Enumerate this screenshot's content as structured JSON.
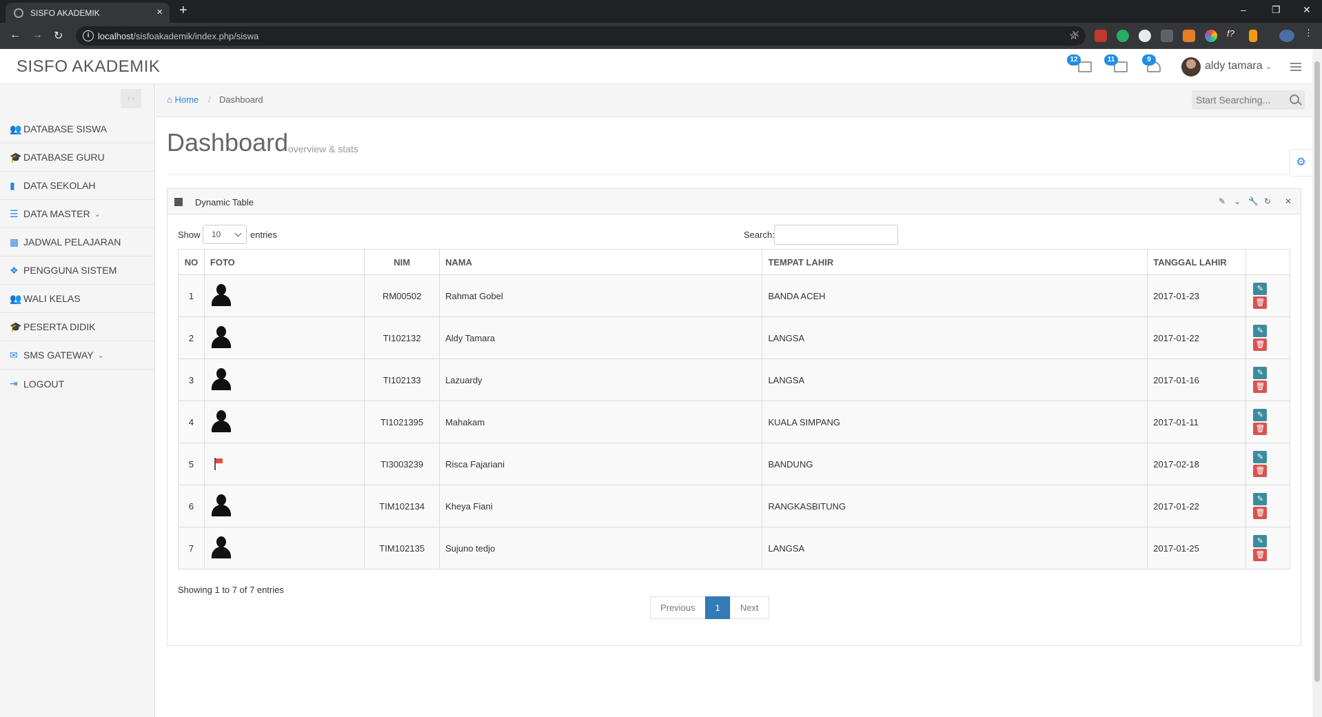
{
  "browser": {
    "tab_title": "SISFO AKADEMIK",
    "url_host": "localhost",
    "url_path": "/sisfoakademik/index.php/siswa"
  },
  "header": {
    "brand": "SISFO AKADEMIK",
    "badges": {
      "messages": "12",
      "notifications": "11",
      "tasks": "9"
    },
    "user_name": "aldy tamara"
  },
  "sidebar": {
    "items": [
      {
        "label": "DATABASE SISWA",
        "icon": "users-icon"
      },
      {
        "label": "DATABASE GURU",
        "icon": "graduation-cap-icon"
      },
      {
        "label": "DATA SEKOLAH",
        "icon": "book-icon"
      },
      {
        "label": "DATA MASTER",
        "icon": "list-icon"
      },
      {
        "label": "JADWAL PELAJARAN",
        "icon": "calendar-icon"
      },
      {
        "label": "PENGGUNA SISTEM",
        "icon": "cubes-icon"
      },
      {
        "label": "WALI KELAS",
        "icon": "users-icon"
      },
      {
        "label": "PESERTA DIDIK",
        "icon": "graduation-cap-icon"
      },
      {
        "label": "SMS GATEWAY",
        "icon": "envelope-icon"
      },
      {
        "label": "LOGOUT",
        "icon": "sign-out-icon"
      }
    ]
  },
  "breadcrumb": {
    "home": "Home",
    "current": "Dashboard"
  },
  "search": {
    "placeholder": "Start Searching..."
  },
  "page": {
    "title": "Dashboard",
    "subtitle": "overview & stats"
  },
  "widget": {
    "title": "Dynamic Table",
    "show_label": "Show",
    "entries_value": "10",
    "entries_label": "entries",
    "search_label": "Search:",
    "columns": [
      "NO",
      "FOTO",
      "NIM",
      "NAMA",
      "TEMPAT LAHIR",
      "TANGGAL LAHIR"
    ],
    "rows": [
      {
        "no": "1",
        "photo": "person-silhouette",
        "nim": "RM00502",
        "nama": "Rahmat Gobel",
        "tempat_lahir": "BANDA ACEH",
        "tanggal_lahir": "2017-01-23"
      },
      {
        "no": "2",
        "photo": "person-silhouette",
        "nim": "TI102132",
        "nama": "Aldy Tamara",
        "tempat_lahir": "LANGSA",
        "tanggal_lahir": "2017-01-22"
      },
      {
        "no": "3",
        "photo": "person-silhouette",
        "nim": "TI102133",
        "nama": "Lazuardy",
        "tempat_lahir": "LANGSA",
        "tanggal_lahir": "2017-01-16"
      },
      {
        "no": "4",
        "photo": "person-silhouette",
        "nim": "TI1021395",
        "nama": "Mahakam",
        "tempat_lahir": "KUALA SIMPANG",
        "tanggal_lahir": "2017-01-11"
      },
      {
        "no": "5",
        "photo": "flag-image",
        "nim": "TI3003239",
        "nama": "Risca Fajariani",
        "tempat_lahir": "BANDUNG",
        "tanggal_lahir": "2017-02-18"
      },
      {
        "no": "6",
        "photo": "person-silhouette",
        "nim": "TIM102134",
        "nama": "Kheya Fiani",
        "tempat_lahir": "RANGKASBITUNG",
        "tanggal_lahir": "2017-01-22"
      },
      {
        "no": "7",
        "photo": "person-silhouette",
        "nim": "TIM102135",
        "nama": "Sujuno tedjo",
        "tempat_lahir": "LANGSA",
        "tanggal_lahir": "2017-01-25"
      }
    ],
    "info": "Showing 1 to 7 of 7 entries",
    "pagination": {
      "previous": "Previous",
      "current": "1",
      "next": "Next"
    }
  },
  "colors": {
    "accent": "#2e86de",
    "edit": "#3d8b9e",
    "delete": "#d9534f",
    "badge": "#1f8fe6",
    "page_active": "#337ab7"
  }
}
